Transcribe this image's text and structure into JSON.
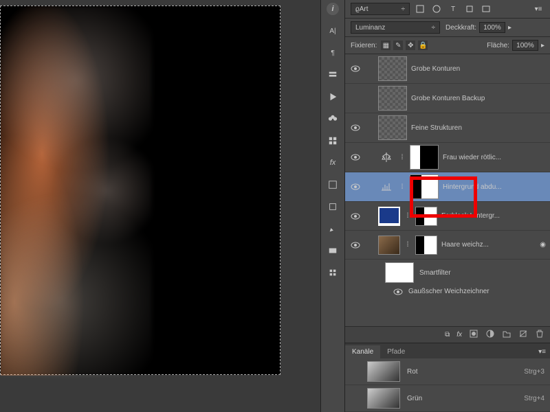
{
  "layers_panel": {
    "filter_label": "Art",
    "blend_mode": "Luminanz",
    "opacity_label": "Deckkraft:",
    "opacity_value": "100%",
    "lock_label": "Fixieren:",
    "fill_label": "Fläche:",
    "fill_value": "100%",
    "layers": [
      {
        "name": "Grobe Konturen"
      },
      {
        "name": "Grobe Konturen Backup"
      },
      {
        "name": "Feine Strukturen"
      },
      {
        "name": "Frau wieder rötlic..."
      },
      {
        "name": "Hintergrund abdu..."
      },
      {
        "name": "Farblook Hintergr..."
      },
      {
        "name": "Haare weichz..."
      }
    ],
    "smartfilter_label": "Smartfilter",
    "gaussian_label": "Gaußscher Weichzeichner"
  },
  "channels_panel": {
    "tab_channels": "Kanäle",
    "tab_paths": "Pfade",
    "channels": [
      {
        "name": "Rot",
        "shortcut": "Strg+3"
      },
      {
        "name": "Grün",
        "shortcut": "Strg+4"
      }
    ]
  }
}
